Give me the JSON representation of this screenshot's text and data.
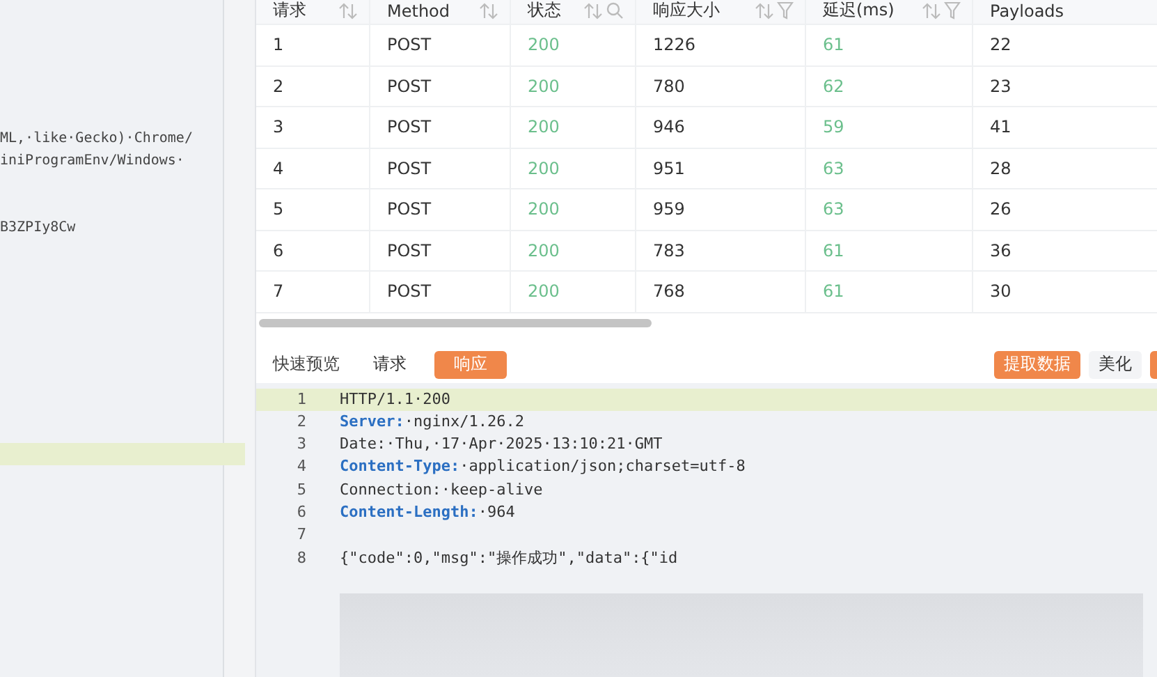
{
  "left_code": {
    "lines": [
      "ML,·like·Gecko)·Chrome/",
      "iniProgramEnv/Windows·",
      "B3ZPIy8Cw"
    ]
  },
  "table": {
    "columns": [
      {
        "label": "请求",
        "kind": "plain",
        "sort": true,
        "search": false,
        "filter": false
      },
      {
        "label": "Method",
        "kind": "plain",
        "sort": true,
        "search": false,
        "filter": false
      },
      {
        "label": "状态",
        "kind": "status",
        "sort": true,
        "search": true,
        "filter": false
      },
      {
        "label": "响应大小",
        "kind": "plain",
        "sort": true,
        "search": false,
        "filter": true
      },
      {
        "label": "延迟(ms)",
        "kind": "status",
        "sort": true,
        "search": false,
        "filter": true
      },
      {
        "label": "Payloads",
        "kind": "plain",
        "sort": false,
        "search": false,
        "filter": false
      }
    ],
    "rows": [
      [
        "1",
        "POST",
        "200",
        "1226",
        "61",
        "22"
      ],
      [
        "2",
        "POST",
        "200",
        "780",
        "62",
        "23"
      ],
      [
        "3",
        "POST",
        "200",
        "946",
        "59",
        "41"
      ],
      [
        "4",
        "POST",
        "200",
        "951",
        "63",
        "28"
      ],
      [
        "5",
        "POST",
        "200",
        "959",
        "63",
        "26"
      ],
      [
        "6",
        "POST",
        "200",
        "783",
        "61",
        "36"
      ],
      [
        "7",
        "POST",
        "200",
        "768",
        "61",
        "30"
      ]
    ]
  },
  "preview": {
    "label": "快速预览",
    "tabs": [
      {
        "label": "请求",
        "selected": false
      },
      {
        "label": "响应",
        "selected": true
      }
    ],
    "actions": [
      {
        "label": "提取数据",
        "kind": "primary"
      },
      {
        "label": "美化",
        "kind": "plain"
      }
    ]
  },
  "editor": {
    "lines": [
      {
        "number": "1",
        "highlighted": true,
        "parts": [
          {
            "text": "HTTP/1.1·200",
            "kind": "plain"
          }
        ]
      },
      {
        "number": "2",
        "highlighted": false,
        "parts": [
          {
            "text": "Server:",
            "kind": "key"
          },
          {
            "text": "·nginx/1.26.2",
            "kind": "plain"
          }
        ]
      },
      {
        "number": "3",
        "highlighted": false,
        "parts": [
          {
            "text": "Date:·Thu,·17·Apr·2025·13:10:21·GMT",
            "kind": "plain"
          }
        ]
      },
      {
        "number": "4",
        "highlighted": false,
        "parts": [
          {
            "text": "Content-Type:",
            "kind": "key"
          },
          {
            "text": "·application/json;charset=utf-8",
            "kind": "plain"
          }
        ]
      },
      {
        "number": "5",
        "highlighted": false,
        "parts": [
          {
            "text": "Connection:·keep-alive",
            "kind": "plain"
          }
        ]
      },
      {
        "number": "6",
        "highlighted": false,
        "parts": [
          {
            "text": "Content-Length:",
            "kind": "key"
          },
          {
            "text": "·964",
            "kind": "plain"
          }
        ]
      },
      {
        "number": "7",
        "highlighted": false
      },
      {
        "number": "8",
        "highlighted": false,
        "parts": [
          {
            "text": "{\"code\":0,\"msg\":\"操作成功\",\"data\":{\"id",
            "kind": "plain"
          }
        ]
      }
    ]
  }
}
